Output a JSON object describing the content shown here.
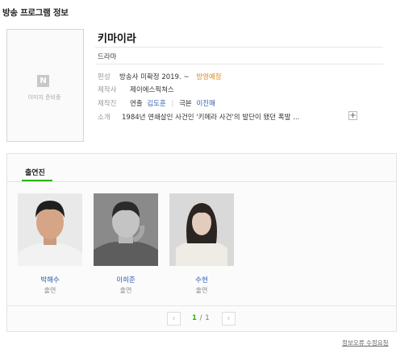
{
  "page_title": "방송 프로그램 정보",
  "poster": {
    "badge": "N",
    "placeholder_text": "이미지 준비중"
  },
  "program": {
    "title": "키마이라",
    "genre": "드라마",
    "broadcast_label": "편성",
    "broadcast_value": "방송사 미확정 2019. ~",
    "broadcast_status": "방영예정",
    "producer_label": "제작사",
    "producer_value": "제이에스픽쳐스",
    "crew_label": "제작진",
    "director_label": "연출",
    "director_name": "김도훈",
    "writer_label": "극본",
    "writer_name": "이진매",
    "synopsis_label": "소개",
    "synopsis_text": "1984년 연쇄살인 사건인 '키메라 사건'의 발단이 됐던 폭발 ...",
    "more_symbol": "+"
  },
  "cast_section": {
    "tab_label": "출연진",
    "members": [
      {
        "name": "박해수",
        "role": "출연"
      },
      {
        "name": "이희준",
        "role": "출연"
      },
      {
        "name": "수현",
        "role": "출연"
      }
    ],
    "pager": {
      "current": "1",
      "separator": "/",
      "total": "1",
      "prev_icon": "chevron-left",
      "next_icon": "chevron-right"
    }
  },
  "report_link": "정보오류 수정요청",
  "colors": {
    "accent_green": "#2db400",
    "link_blue": "#2d5fb3",
    "status_orange": "#d98a1a"
  }
}
